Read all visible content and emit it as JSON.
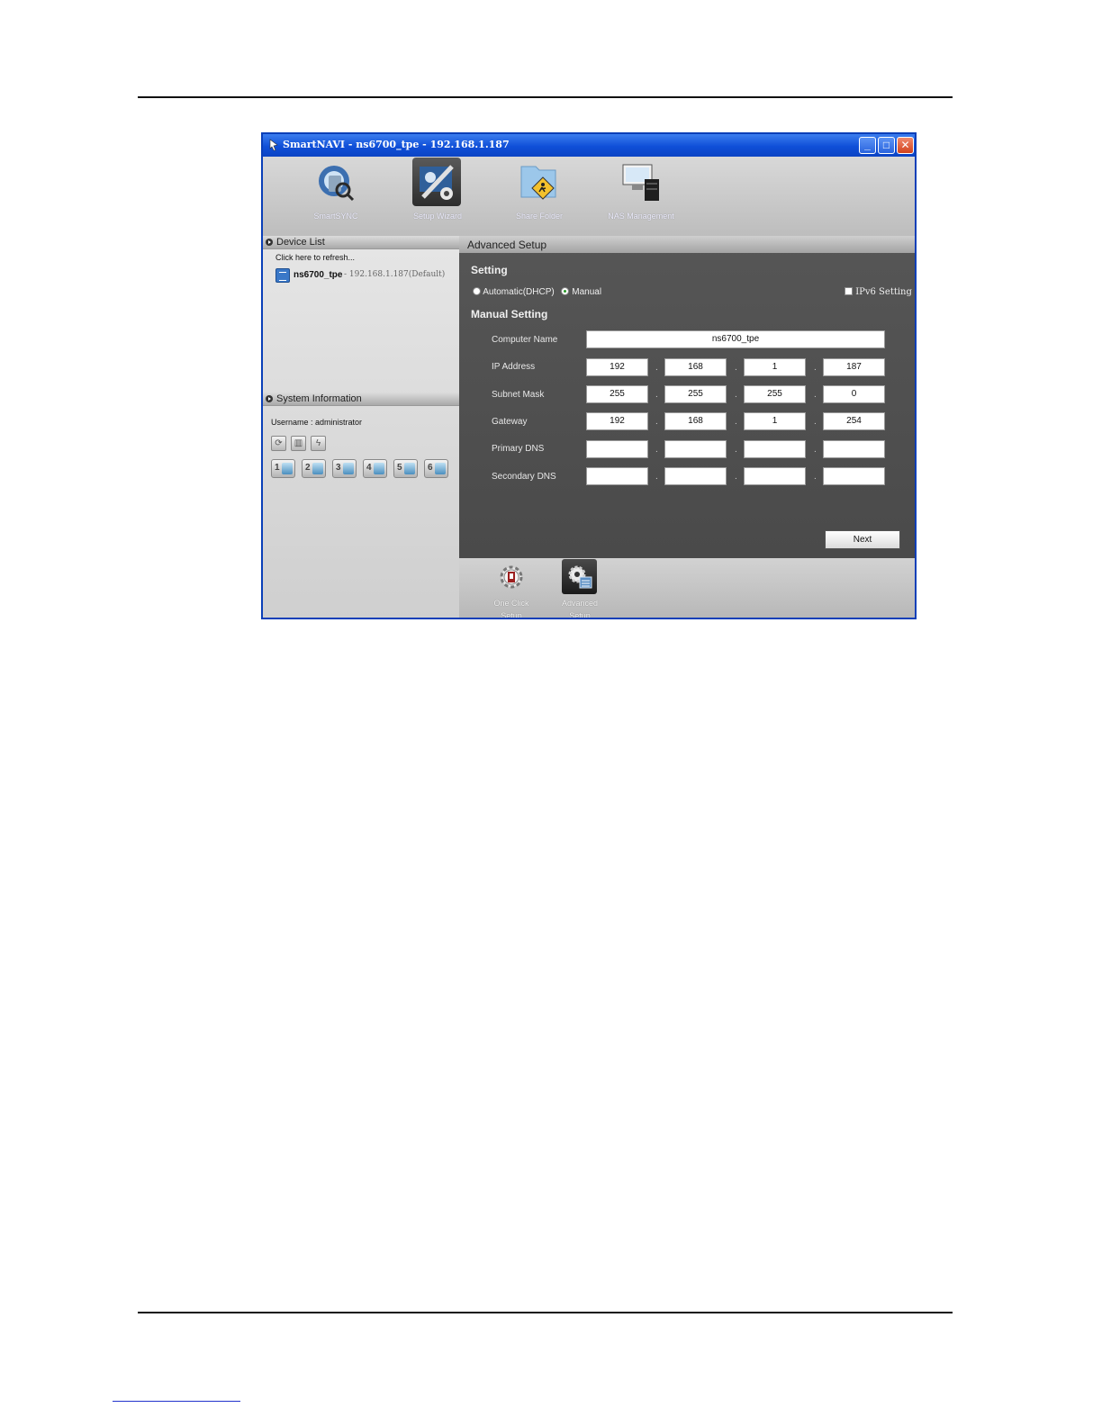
{
  "window": {
    "title": "SmartNAVI - ns6700_tpe - 192.168.1.187",
    "minimize_label": "_",
    "maximize_label": "□",
    "close_label": "✕"
  },
  "toolbar": {
    "items": [
      {
        "label": "SmartSYNC",
        "icon": "smartsync-icon"
      },
      {
        "label": "Setup Wizard",
        "icon": "setup-wizard-icon"
      },
      {
        "label": "Share Folder",
        "icon": "share-folder-icon"
      },
      {
        "label": "NAS Management",
        "icon": "nas-management-icon"
      }
    ],
    "active": "Setup Wizard"
  },
  "device_list": {
    "header": "Device List",
    "refresh_text": "Click here to refresh...",
    "devices": [
      {
        "name": "ns6700_tpe",
        "ip": "- 192.168.1.187(Default)"
      }
    ]
  },
  "system_info": {
    "header": "System Information",
    "username": "Username : administrator",
    "disks": [
      "1",
      "2",
      "3",
      "4",
      "5",
      "6"
    ]
  },
  "advanced_setup": {
    "header": "Advanced Setup",
    "setting_title": "Setting",
    "mode_auto": "Automatic(DHCP)",
    "mode_manual": "Manual",
    "selected_mode": "Manual",
    "ipv6_label": "IPv6 Setting",
    "manual_title": "Manual Setting",
    "computer_name_label": "Computer Name",
    "computer_name": "ns6700_tpe",
    "rows": [
      {
        "label": "IP Address",
        "values": [
          "192",
          "168",
          "1",
          "187"
        ]
      },
      {
        "label": "Subnet Mask",
        "values": [
          "255",
          "255",
          "255",
          "0"
        ]
      },
      {
        "label": "Gateway",
        "values": [
          "192",
          "168",
          "1",
          "254"
        ]
      },
      {
        "label": "Primary DNS",
        "values": [
          "",
          "",
          "",
          ""
        ]
      },
      {
        "label": "Secondary DNS",
        "values": [
          "",
          "",
          "",
          ""
        ]
      }
    ],
    "next_label": "Next"
  },
  "bottom_bar": {
    "one_click_line1": "One Click",
    "one_click_line2": "Setup",
    "advanced_line1": "Advanced",
    "advanced_line2": "Setup"
  }
}
